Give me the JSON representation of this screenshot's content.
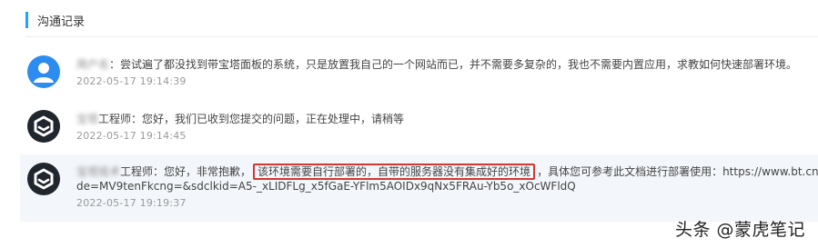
{
  "section": {
    "title": "沟通记录"
  },
  "messages": [
    {
      "role": "user",
      "sender": "用户名",
      "suffix": "：",
      "text": "尝试遍了都没找到带宝塔面板的系统，只是放置我自己的一个网站而已，并不需要多复杂的，我也不需要内置应用，求教如何快速部署环境。",
      "time": "2022-05-17 19:14:39",
      "avatar_icon": "user-icon"
    },
    {
      "role": "support",
      "sender": "宝塔",
      "suffix": "工程师：",
      "text": "您好，我们已收到您提交的问题，正在处理中，请稍等",
      "time": "2022-05-17 19:14:45",
      "avatar_icon": "hexagon-logo-icon"
    },
    {
      "role": "support",
      "sender": "宝塔技术",
      "suffix": "工程师：",
      "text_before": "您好，非常抱歉，",
      "text_highlight": "该环境需要自行部署的，自带的服务器没有集成好的环境",
      "text_after": "，具体您可参考此文档进行部署使用：https://www.bt.cn/lin",
      "text_line2": "de=MV9tenFkcng=&sdclkid=A5-_xLIDFLg_x5fGaE-YFlm5AOIDx9qNx5FRAu-Yb5o_xOcWFldQ",
      "time": "2022-05-17 19:19:37",
      "avatar_icon": "hexagon-logo-icon"
    }
  ],
  "watermark": "头条 @蒙虎笔记",
  "colors": {
    "accent": "#20a0ff",
    "highlight_border": "#d6372f",
    "user_avatar": "#2d8cf0",
    "support_avatar": "#20262d"
  }
}
